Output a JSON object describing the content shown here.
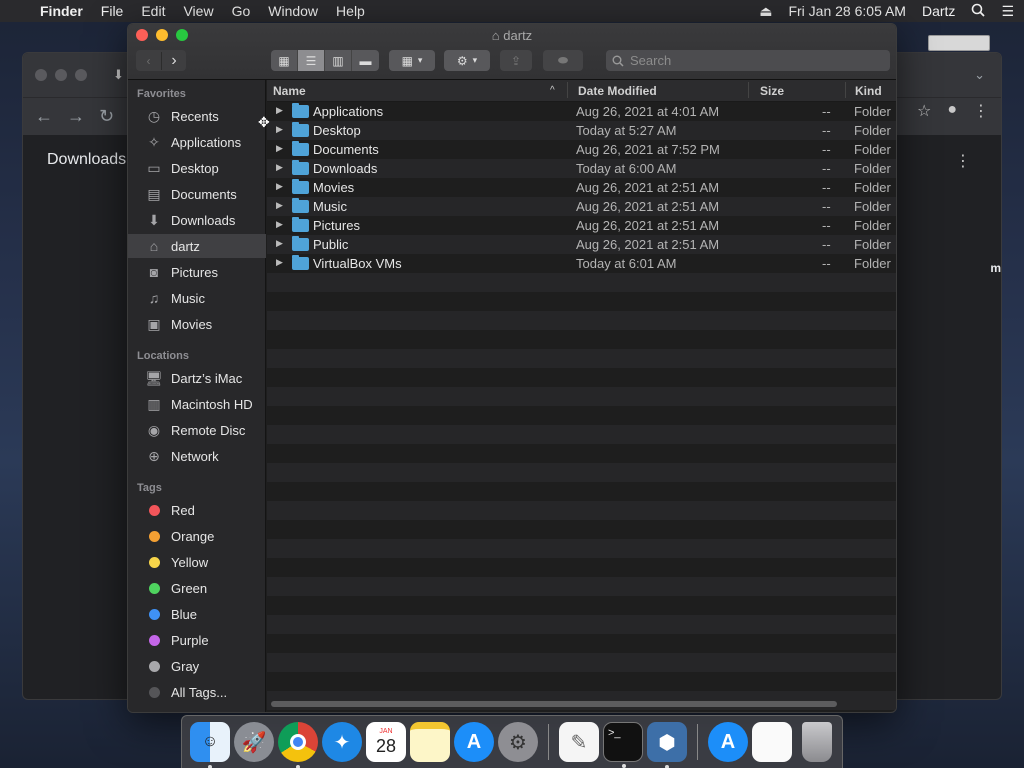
{
  "menubar": {
    "items": [
      "Finder",
      "File",
      "Edit",
      "View",
      "Go",
      "Window",
      "Help"
    ],
    "datetime": "Fri Jan 28  6:05 AM",
    "user": "Dartz"
  },
  "browser": {
    "page_title": "Downloads",
    "truncated_text": "m"
  },
  "finder": {
    "title": "dartz",
    "search_placeholder": "Search",
    "sidebar": {
      "favorites_header": "Favorites",
      "favorites": [
        {
          "label": "Recents",
          "icon": "recents-icon"
        },
        {
          "label": "Applications",
          "icon": "applications-icon"
        },
        {
          "label": "Desktop",
          "icon": "desktop-icon"
        },
        {
          "label": "Documents",
          "icon": "documents-icon"
        },
        {
          "label": "Downloads",
          "icon": "downloads-icon"
        },
        {
          "label": "dartz",
          "icon": "home-icon"
        },
        {
          "label": "Pictures",
          "icon": "pictures-icon"
        },
        {
          "label": "Music",
          "icon": "music-icon"
        },
        {
          "label": "Movies",
          "icon": "movies-icon"
        }
      ],
      "locations_header": "Locations",
      "locations": [
        {
          "label": "Dartz’s iMac",
          "icon": "imac-icon"
        },
        {
          "label": "Macintosh HD",
          "icon": "disk-icon"
        },
        {
          "label": "Remote Disc",
          "icon": "disc-icon"
        },
        {
          "label": "Network",
          "icon": "network-icon"
        }
      ],
      "tags_header": "Tags",
      "tags": [
        {
          "label": "Red",
          "color": "#f2555a"
        },
        {
          "label": "Orange",
          "color": "#f4a033"
        },
        {
          "label": "Yellow",
          "color": "#f7d54a"
        },
        {
          "label": "Green",
          "color": "#4fd35f"
        },
        {
          "label": "Blue",
          "color": "#3f91f5"
        },
        {
          "label": "Purple",
          "color": "#c466e8"
        },
        {
          "label": "Gray",
          "color": "#a8a8ab"
        },
        {
          "label": "All Tags...",
          "color": "#555558"
        }
      ]
    },
    "columns": {
      "name": "Name",
      "date": "Date Modified",
      "size": "Size",
      "kind": "Kind"
    },
    "files": [
      {
        "name": "Applications",
        "date": "Aug 26, 2021 at 4:01 AM",
        "size": "--",
        "kind": "Folder"
      },
      {
        "name": "Desktop",
        "date": "Today at 5:27 AM",
        "size": "--",
        "kind": "Folder"
      },
      {
        "name": "Documents",
        "date": "Aug 26, 2021 at 7:52 PM",
        "size": "--",
        "kind": "Folder"
      },
      {
        "name": "Downloads",
        "date": "Today at 6:00 AM",
        "size": "--",
        "kind": "Folder"
      },
      {
        "name": "Movies",
        "date": "Aug 26, 2021 at 2:51 AM",
        "size": "--",
        "kind": "Folder"
      },
      {
        "name": "Music",
        "date": "Aug 26, 2021 at 2:51 AM",
        "size": "--",
        "kind": "Folder"
      },
      {
        "name": "Pictures",
        "date": "Aug 26, 2021 at 2:51 AM",
        "size": "--",
        "kind": "Folder"
      },
      {
        "name": "Public",
        "date": "Aug 26, 2021 at 2:51 AM",
        "size": "--",
        "kind": "Folder"
      },
      {
        "name": "VirtualBox VMs",
        "date": "Today at 6:01 AM",
        "size": "--",
        "kind": "Folder"
      }
    ]
  },
  "dock": {
    "calendar_month": "JAN",
    "calendar_day": "28",
    "apps": [
      "finder-icon",
      "launchpad-icon",
      "chrome-icon",
      "safari-icon",
      "calendar-icon",
      "notes-icon",
      "app-store-icon",
      "system-preferences-icon",
      "textedit-icon",
      "terminal-icon",
      "virtualbox-icon",
      "app-store-downloads-icon",
      "document-icon",
      "trash-icon"
    ],
    "terminal_prompt": ">_"
  }
}
